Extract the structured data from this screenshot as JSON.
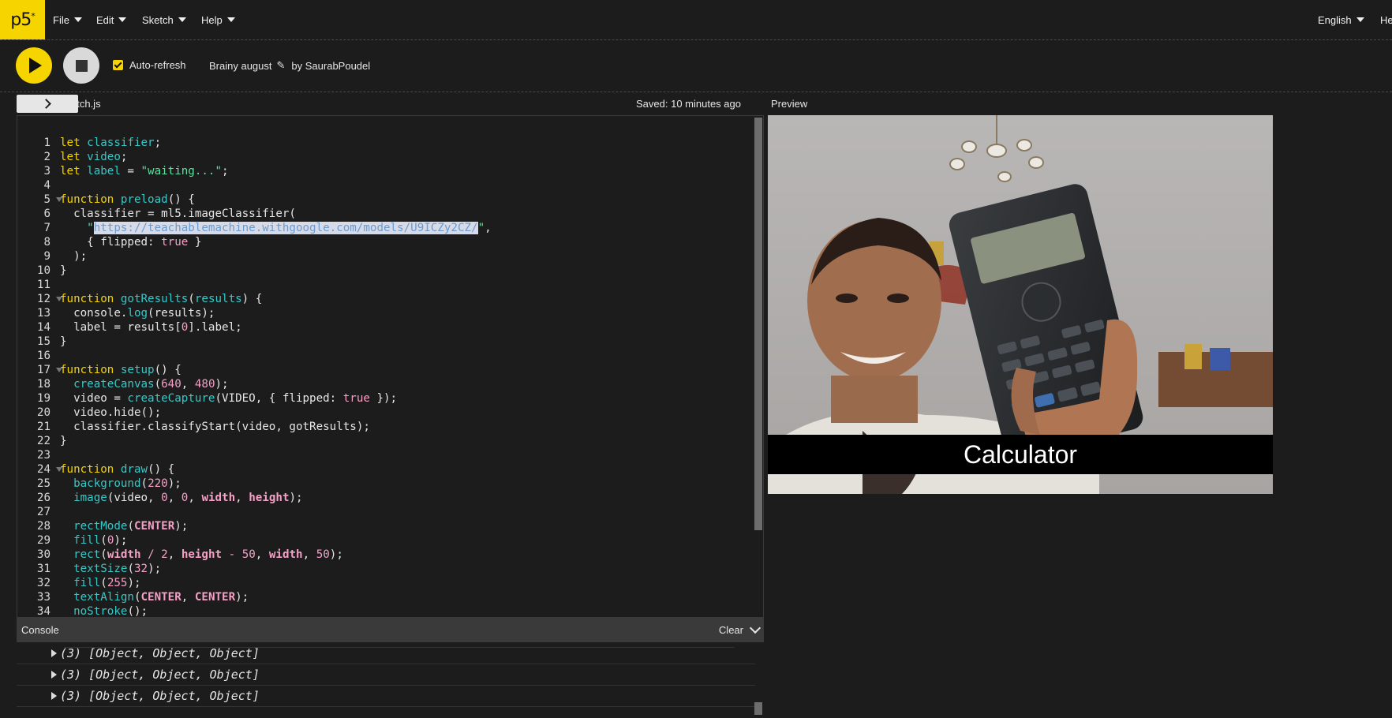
{
  "brand": {
    "logo": "p5"
  },
  "nav": {
    "menus": [
      {
        "label": "File"
      },
      {
        "label": "Edit"
      },
      {
        "label": "Sketch"
      },
      {
        "label": "Help"
      }
    ],
    "language": "English",
    "cut_right": "He"
  },
  "toolbar": {
    "autorefresh_label": "Auto-refresh",
    "autorefresh_checked": true,
    "project_name": "Brainy august",
    "author": "by SaurabPoudel"
  },
  "editor": {
    "filename": "sketch.js",
    "saved_status": "Saved: 10 minutes ago",
    "line_numbers": [
      "1",
      "2",
      "3",
      "4",
      "5",
      "6",
      "7",
      "8",
      "9",
      "10",
      "11",
      "12",
      "13",
      "14",
      "15",
      "16",
      "17",
      "18",
      "19",
      "20",
      "21",
      "22",
      "23",
      "24",
      "25",
      "26",
      "27",
      "28",
      "29",
      "30",
      "31",
      "32",
      "33",
      "34"
    ],
    "fold_lines": [
      5,
      12,
      17,
      24
    ]
  },
  "preview": {
    "title": "Preview",
    "classification_label": "Calculator"
  },
  "console": {
    "title": "Console",
    "clear_label": "Clear",
    "logs": [
      "(3) [Object, Object, Object]",
      "(3) [Object, Object, Object]",
      "(3) [Object, Object, Object]"
    ]
  },
  "colors": {
    "accent": "#f5d400",
    "background": "#1c1c1c",
    "console_bar": "#3a3a3a"
  }
}
